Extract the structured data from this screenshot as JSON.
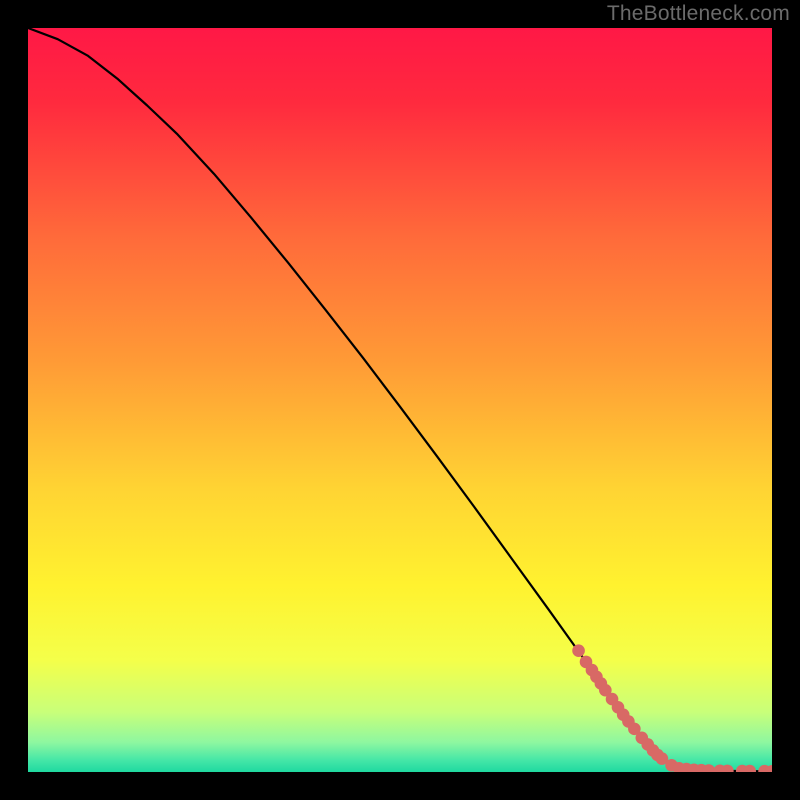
{
  "watermark": "TheBottleneck.com",
  "colors": {
    "bg": "#000000",
    "curve": "#000000",
    "marker": "#d86965",
    "watermark": "#6b6b6b"
  },
  "chart_data": {
    "type": "line",
    "title": "",
    "xlabel": "",
    "ylabel": "",
    "xlim": [
      0,
      100
    ],
    "ylim": [
      0,
      100
    ],
    "grid": false,
    "gradient_stops": [
      {
        "offset": 0.0,
        "color": "#ff1846"
      },
      {
        "offset": 0.1,
        "color": "#ff2a3e"
      },
      {
        "offset": 0.28,
        "color": "#ff6a3a"
      },
      {
        "offset": 0.45,
        "color": "#ff9b36"
      },
      {
        "offset": 0.62,
        "color": "#ffd433"
      },
      {
        "offset": 0.75,
        "color": "#fff22f"
      },
      {
        "offset": 0.85,
        "color": "#f4ff4a"
      },
      {
        "offset": 0.92,
        "color": "#c8ff7a"
      },
      {
        "offset": 0.96,
        "color": "#8ef7a0"
      },
      {
        "offset": 0.985,
        "color": "#43e6a7"
      },
      {
        "offset": 1.0,
        "color": "#1fd9a0"
      }
    ],
    "series": [
      {
        "name": "bottleneck-curve",
        "x": [
          0,
          4,
          8,
          12,
          16,
          20,
          25,
          30,
          35,
          40,
          45,
          50,
          55,
          60,
          65,
          70,
          75,
          80,
          82,
          84,
          85,
          86,
          88,
          90,
          92,
          94,
          96,
          98,
          100
        ],
        "y": [
          100,
          98.5,
          96.3,
          93.2,
          89.6,
          85.8,
          80.4,
          74.5,
          68.4,
          62.1,
          55.7,
          49.1,
          42.4,
          35.6,
          28.7,
          21.8,
          14.8,
          7.7,
          5.2,
          2.9,
          2.0,
          1.3,
          0.6,
          0.3,
          0.2,
          0.15,
          0.12,
          0.1,
          0.1
        ]
      }
    ],
    "markers": {
      "name": "highlight-points",
      "x": [
        74.0,
        75.0,
        75.8,
        76.4,
        77.0,
        77.6,
        78.5,
        79.3,
        80.0,
        80.7,
        81.5,
        82.5,
        83.3,
        84.0,
        84.6,
        85.2,
        86.5,
        87.5,
        88.5,
        89.5,
        90.5,
        91.5,
        93.0,
        94.0,
        96.0,
        97.0,
        99.0,
        100.0
      ],
      "y": [
        16.3,
        14.8,
        13.7,
        12.8,
        11.9,
        11.0,
        9.8,
        8.7,
        7.7,
        6.8,
        5.8,
        4.6,
        3.7,
        2.9,
        2.3,
        1.8,
        0.9,
        0.5,
        0.4,
        0.3,
        0.25,
        0.2,
        0.17,
        0.15,
        0.13,
        0.12,
        0.11,
        0.1
      ]
    }
  }
}
